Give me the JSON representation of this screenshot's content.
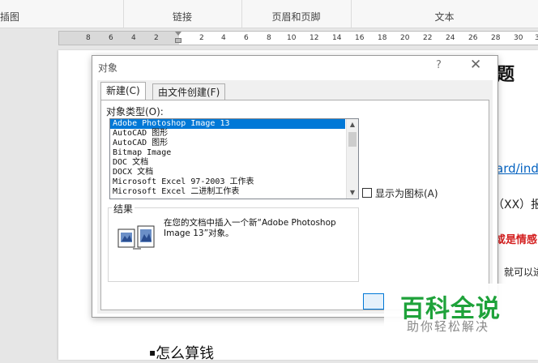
{
  "ribbon": {
    "groups": [
      "插图",
      "链接",
      "页眉和页脚",
      "文本"
    ]
  },
  "ruler": {
    "left_ticks": [
      "8",
      "6",
      "4",
      "2"
    ],
    "right_ticks": [
      "2",
      "4",
      "6",
      "8",
      "10",
      "12",
      "14",
      "16",
      "18",
      "20",
      "22",
      "24",
      "26",
      "28",
      "30",
      "32"
    ]
  },
  "document": {
    "title_tail": "题",
    "link_text": "ard/ind",
    "line_xx": "（XX）报",
    "red_text": "或是情感",
    "line_last": "就可以进",
    "bullet_heading": "怎么算钱"
  },
  "dialog": {
    "title": "对象",
    "help": "?",
    "close": "✕",
    "tabs": [
      "新建(C)",
      "由文件创建(F)"
    ],
    "object_type_label": "对象类型(O):",
    "object_types": [
      "Adobe Photoshop Image 13",
      "AutoCAD 图形",
      "AutoCAD 图形",
      "Bitmap Image",
      "DOC 文档",
      "DOCX 文档",
      "Microsoft Excel 97-2003 工作表",
      "Microsoft Excel 二进制工作表"
    ],
    "selected_index": 0,
    "show_as_icon_label": "显示为图标(A)",
    "result_label": "结果",
    "result_text": "在您的文档中插入一个新“Adobe Photoshop Image 13”对象。"
  },
  "watermark": {
    "brand": "百科全说",
    "slogan": "助你轻松解决"
  },
  "colors": {
    "selection": "#0078d7",
    "link": "#0563c1",
    "red": "#d42020",
    "brand_green": "#1ea23a"
  }
}
